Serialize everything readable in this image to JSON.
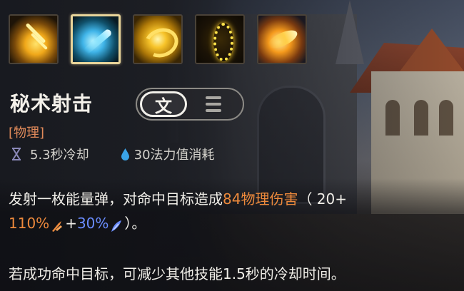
{
  "skill_bar": {
    "icons": [
      {
        "name": "skill-icon-1",
        "art": "lightning-streak-icon"
      },
      {
        "name": "skill-icon-2",
        "art": "blue-projectile-icon",
        "selected": true
      },
      {
        "name": "skill-icon-3",
        "art": "golden-swirl-icon"
      },
      {
        "name": "skill-icon-4",
        "art": "sparkle-ring-icon"
      },
      {
        "name": "skill-icon-5",
        "art": "fire-comet-icon"
      }
    ]
  },
  "skill": {
    "title": "秘术射击",
    "type_tag": "[物理]",
    "cooldown": "5.3秒冷却",
    "cost": "30法力值消耗"
  },
  "toggle": {
    "text_glyph": "文",
    "active": "text"
  },
  "description": {
    "line1_prefix": "发射一枚能量弹，对命中目标造成",
    "line1_highlight": "84物理伤害",
    "line1_suffix": "（ 20+",
    "line2_ad": "110%",
    "line2_plus": "+",
    "line2_ap": "30%",
    "line2_suffix": "）。",
    "line3": "若成功命中目标，可减少其他技能1.5秒的冷却时间。"
  },
  "colors": {
    "highlight_orange": "#ee8a3c",
    "ap_blue": "#6a8cff",
    "type_tag": "#e08a5a",
    "selected_border": "#e8d49a"
  }
}
